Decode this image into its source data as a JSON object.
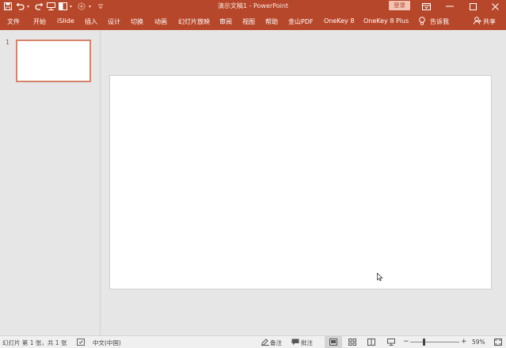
{
  "window": {
    "title": "演示文稿1  -  PowerPoint",
    "login_label": "登录"
  },
  "quick_access": {
    "icons": [
      "save-icon",
      "undo-icon",
      "redo-icon",
      "presentation-icon",
      "layout-icon",
      "paint-icon",
      "customize-icon"
    ]
  },
  "ribbon": {
    "tabs": [
      "文件",
      "开始",
      "iSlide",
      "插入",
      "设计",
      "切换",
      "动画",
      "幻灯片放映",
      "审阅",
      "视图",
      "帮助",
      "金山PDF",
      "OneKey 8",
      "OneKey 8 Plus"
    ],
    "tell_me_label": "告诉我",
    "share_label": "共享"
  },
  "thumbnails": [
    {
      "number": "1"
    }
  ],
  "status": {
    "slide_info": "幻灯片 第 1 张，共 1 张",
    "language": "中文(中国)",
    "notes_label": "备注",
    "comments_label": "批注",
    "zoom_minus": "−",
    "zoom_plus": "+",
    "zoom": "59%",
    "zoom_level": 0.59
  },
  "colors": {
    "accent": "#b7472a",
    "thumb_border": "#d6836a"
  }
}
